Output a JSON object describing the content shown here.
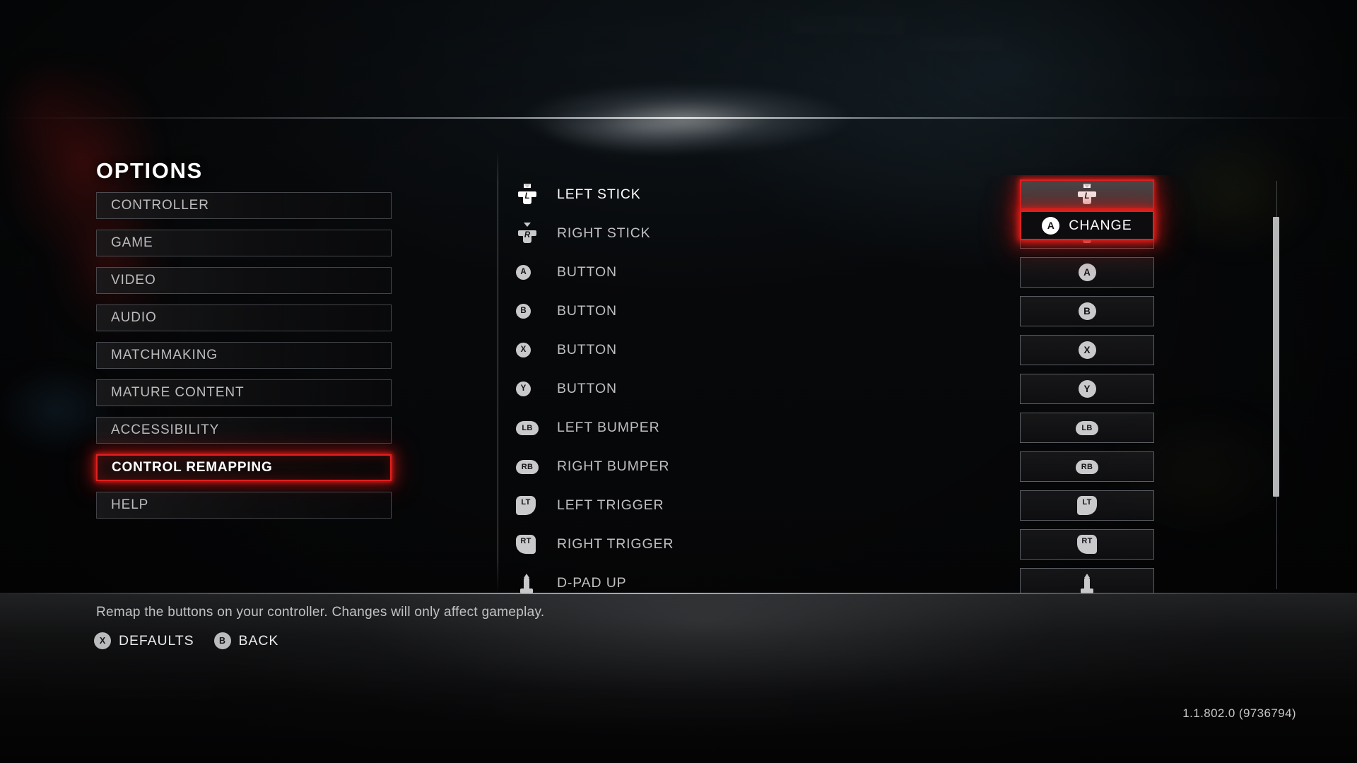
{
  "screen": {
    "title": "OPTIONS",
    "version": "1.1.802.0 (9736794)"
  },
  "sidebar": {
    "items": [
      {
        "label": "CONTROLLER",
        "selected": false
      },
      {
        "label": "GAME",
        "selected": false
      },
      {
        "label": "VIDEO",
        "selected": false
      },
      {
        "label": "AUDIO",
        "selected": false
      },
      {
        "label": "MATCHMAKING",
        "selected": false
      },
      {
        "label": "MATURE CONTENT",
        "selected": false
      },
      {
        "label": "ACCESSIBILITY",
        "selected": false
      },
      {
        "label": "CONTROL REMAPPING",
        "selected": true
      },
      {
        "label": "HELP",
        "selected": false
      }
    ]
  },
  "bindings": {
    "rows": [
      {
        "label": "LEFT STICK",
        "icon": "left-stick-icon",
        "binding": "LS",
        "binding_icon": "left-stick-icon",
        "focused": true
      },
      {
        "label": "RIGHT STICK",
        "icon": "right-stick-icon",
        "binding": "RS",
        "binding_icon": "right-stick-icon",
        "focused": false
      },
      {
        "label": "BUTTON",
        "icon": "a-button-icon",
        "binding": "A",
        "binding_icon": "a-button-icon",
        "focused": false
      },
      {
        "label": "BUTTON",
        "icon": "b-button-icon",
        "binding": "B",
        "binding_icon": "b-button-icon",
        "focused": false
      },
      {
        "label": "BUTTON",
        "icon": "x-button-icon",
        "binding": "X",
        "binding_icon": "x-button-icon",
        "focused": false
      },
      {
        "label": "BUTTON",
        "icon": "y-button-icon",
        "binding": "Y",
        "binding_icon": "y-button-icon",
        "focused": false
      },
      {
        "label": "LEFT BUMPER",
        "icon": "left-bumper-icon",
        "binding": "LB",
        "binding_icon": "left-bumper-icon",
        "focused": false
      },
      {
        "label": "RIGHT BUMPER",
        "icon": "right-bumper-icon",
        "binding": "RB",
        "binding_icon": "right-bumper-icon",
        "focused": false
      },
      {
        "label": "LEFT TRIGGER",
        "icon": "left-trigger-icon",
        "binding": "LT",
        "binding_icon": "left-trigger-icon",
        "focused": false
      },
      {
        "label": "RIGHT TRIGGER",
        "icon": "right-trigger-icon",
        "binding": "RT",
        "binding_icon": "right-trigger-icon",
        "focused": false
      },
      {
        "label": "D-PAD UP",
        "icon": "dpad-up-icon",
        "binding": "DPAD UP",
        "binding_icon": "dpad-up-icon",
        "focused": false
      }
    ]
  },
  "tooltip": {
    "button": "A",
    "label": "CHANGE"
  },
  "footer": {
    "help": "Remap the buttons on your controller. Changes will only affect gameplay.",
    "prompts": [
      {
        "button": "X",
        "label": "DEFAULTS"
      },
      {
        "button": "B",
        "label": "BACK"
      }
    ]
  },
  "colors": {
    "accent_red": "#e02020",
    "glyph_gray": "#c9c9cb",
    "text_primary": "#ffffff",
    "text_secondary": "#bfbfc1"
  }
}
